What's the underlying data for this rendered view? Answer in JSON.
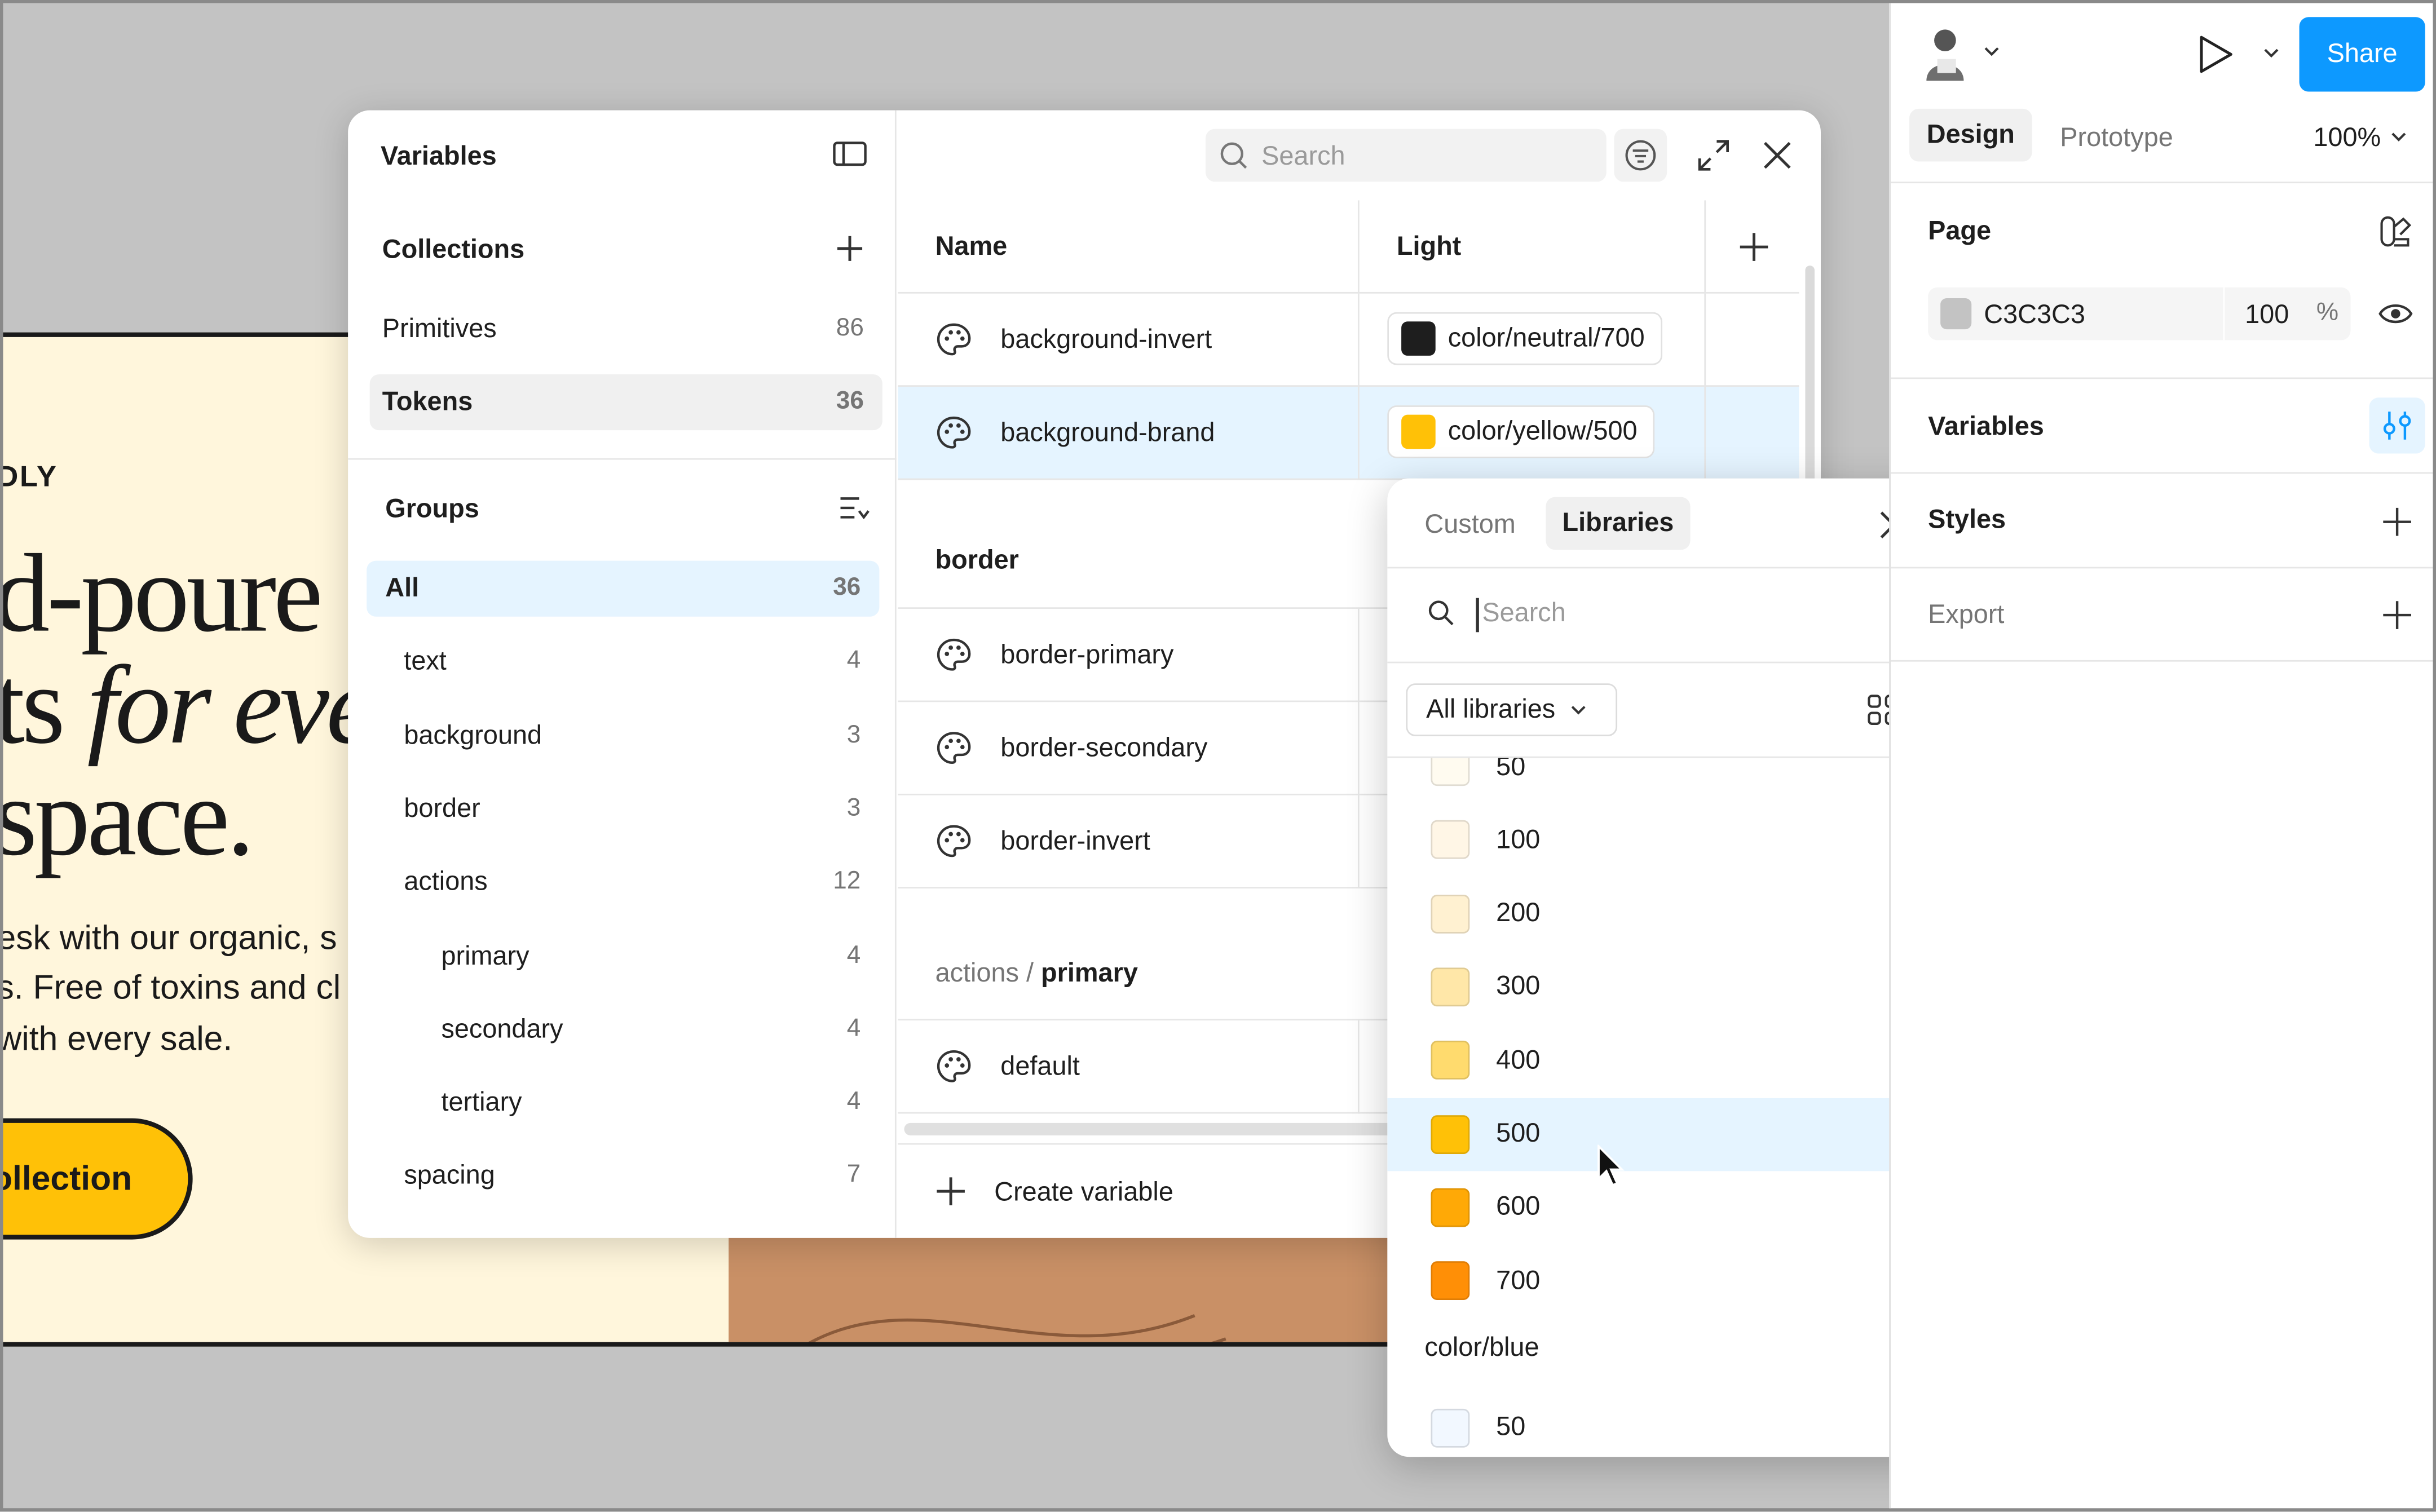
{
  "site": {
    "eyebrow": "DLY",
    "hero_line1": "d-poure",
    "hero_line2_a": "ts ",
    "hero_line2_b": "for eve",
    "hero_line3": "space.",
    "body_line1": "esk with our organic, s",
    "body_line2": "s. Free of toxins and cl",
    "body_line3": " with every sale.",
    "cta": "ollection"
  },
  "variables": {
    "title": "Variables",
    "collections_label": "Collections",
    "collections": [
      {
        "name": "Primitives",
        "count": "86",
        "selected": false
      },
      {
        "name": "Tokens",
        "count": "36",
        "selected": true
      }
    ],
    "groups_label": "Groups",
    "groups": [
      {
        "name": "All",
        "count": "36",
        "selected": true,
        "indent": 0
      },
      {
        "name": "text",
        "count": "4",
        "selected": false,
        "indent": 1
      },
      {
        "name": "background",
        "count": "3",
        "selected": false,
        "indent": 1
      },
      {
        "name": "border",
        "count": "3",
        "selected": false,
        "indent": 1
      },
      {
        "name": "actions",
        "count": "12",
        "selected": false,
        "indent": 1
      },
      {
        "name": "primary",
        "count": "4",
        "selected": false,
        "indent": 2
      },
      {
        "name": "secondary",
        "count": "4",
        "selected": false,
        "indent": 2
      },
      {
        "name": "tertiary",
        "count": "4",
        "selected": false,
        "indent": 2
      },
      {
        "name": "spacing",
        "count": "7",
        "selected": false,
        "indent": 1
      }
    ],
    "search_placeholder": "Search",
    "col_name": "Name",
    "col_mode": "Light",
    "rows": [
      {
        "name": "background-invert",
        "value": "color/neutral/700",
        "swatch": "#1e1e1e"
      },
      {
        "name": "background-brand",
        "value": "color/yellow/500",
        "swatch": "#ffc107"
      }
    ],
    "border_group": "border",
    "border_rows": [
      "border-primary",
      "border-secondary",
      "border-invert"
    ],
    "actions_group_prefix": "actions / ",
    "actions_group_name": "primary",
    "actions_rows": [
      "default"
    ],
    "create_label": "Create variable"
  },
  "picker": {
    "tab_custom": "Custom",
    "tab_libraries": "Libraries",
    "search_placeholder": "Search",
    "filter_label": "All libraries",
    "items": [
      {
        "label": "50",
        "color": "#fffbf0"
      },
      {
        "label": "100",
        "color": "#fff6e6"
      },
      {
        "label": "200",
        "color": "#fff1d1"
      },
      {
        "label": "300",
        "color": "#ffe7a8"
      },
      {
        "label": "400",
        "color": "#ffdb6e"
      },
      {
        "label": "500",
        "color": "#ffc107",
        "selected": true
      },
      {
        "label": "600",
        "color": "#ffa906"
      },
      {
        "label": "700",
        "color": "#ff8f06"
      }
    ],
    "next_group": "color/blue",
    "next_items": [
      {
        "label": "50",
        "color": "#f2f8ff"
      }
    ]
  },
  "panel": {
    "share": "Share",
    "tab_design": "Design",
    "tab_prototype": "Prototype",
    "zoom": "100%",
    "page_label": "Page",
    "page_color": "C3C3C3",
    "page_opacity": "100",
    "page_opacity_unit": "%",
    "variables_label": "Variables",
    "styles_label": "Styles",
    "export_label": "Export"
  }
}
